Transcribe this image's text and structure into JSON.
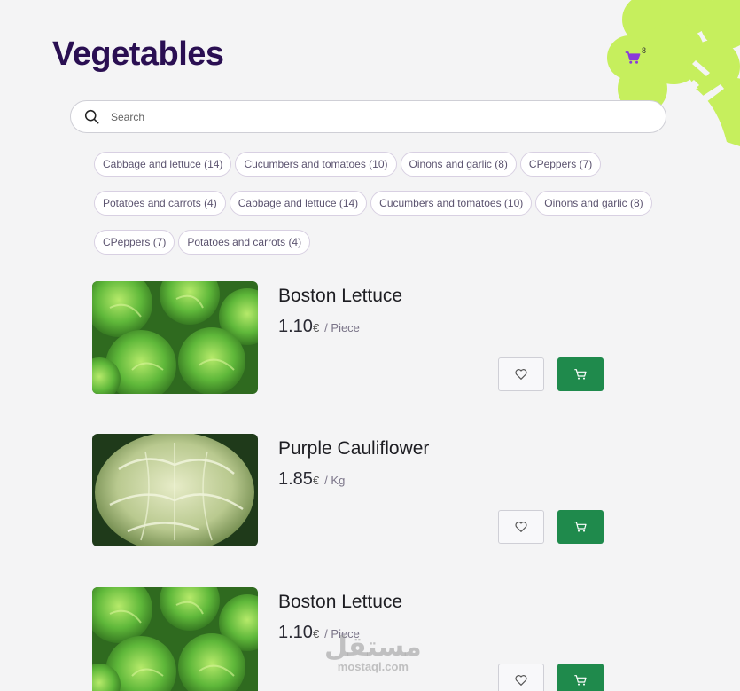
{
  "page": {
    "title": "Vegetables"
  },
  "cart": {
    "count": "8"
  },
  "search": {
    "placeholder": "Search"
  },
  "filters": [
    "Cabbage and lettuce (14)",
    "Cucumbers and tomatoes (10)",
    "Oinons and garlic (8)",
    "CPeppers (7)",
    "Potatoes and carrots (4)",
    "Cabbage and lettuce (14)",
    "Cucumbers and tomatoes (10)",
    "Oinons and garlic (8)",
    "CPeppers (7)",
    "Potatoes and carrots (4)"
  ],
  "products": [
    {
      "name": "Boston Lettuce",
      "price": "1.10",
      "currency": "€",
      "unit": "/ Piece",
      "image": "lettuce"
    },
    {
      "name": "Purple Cauliflower",
      "price": "1.85",
      "currency": "€",
      "unit": "/ Kg",
      "image": "cabbage"
    },
    {
      "name": "Boston Lettuce",
      "price": "1.10",
      "currency": "€",
      "unit": "/ Piece",
      "image": "lettuce"
    }
  ],
  "watermark": {
    "arabic": "مستقل",
    "latin": "mostaql.com"
  },
  "colors": {
    "title": "#2a0f52",
    "accent_green": "#1f8a4c",
    "deco_lime": "#c6ef5d",
    "cart_icon": "#8a3bd9"
  }
}
